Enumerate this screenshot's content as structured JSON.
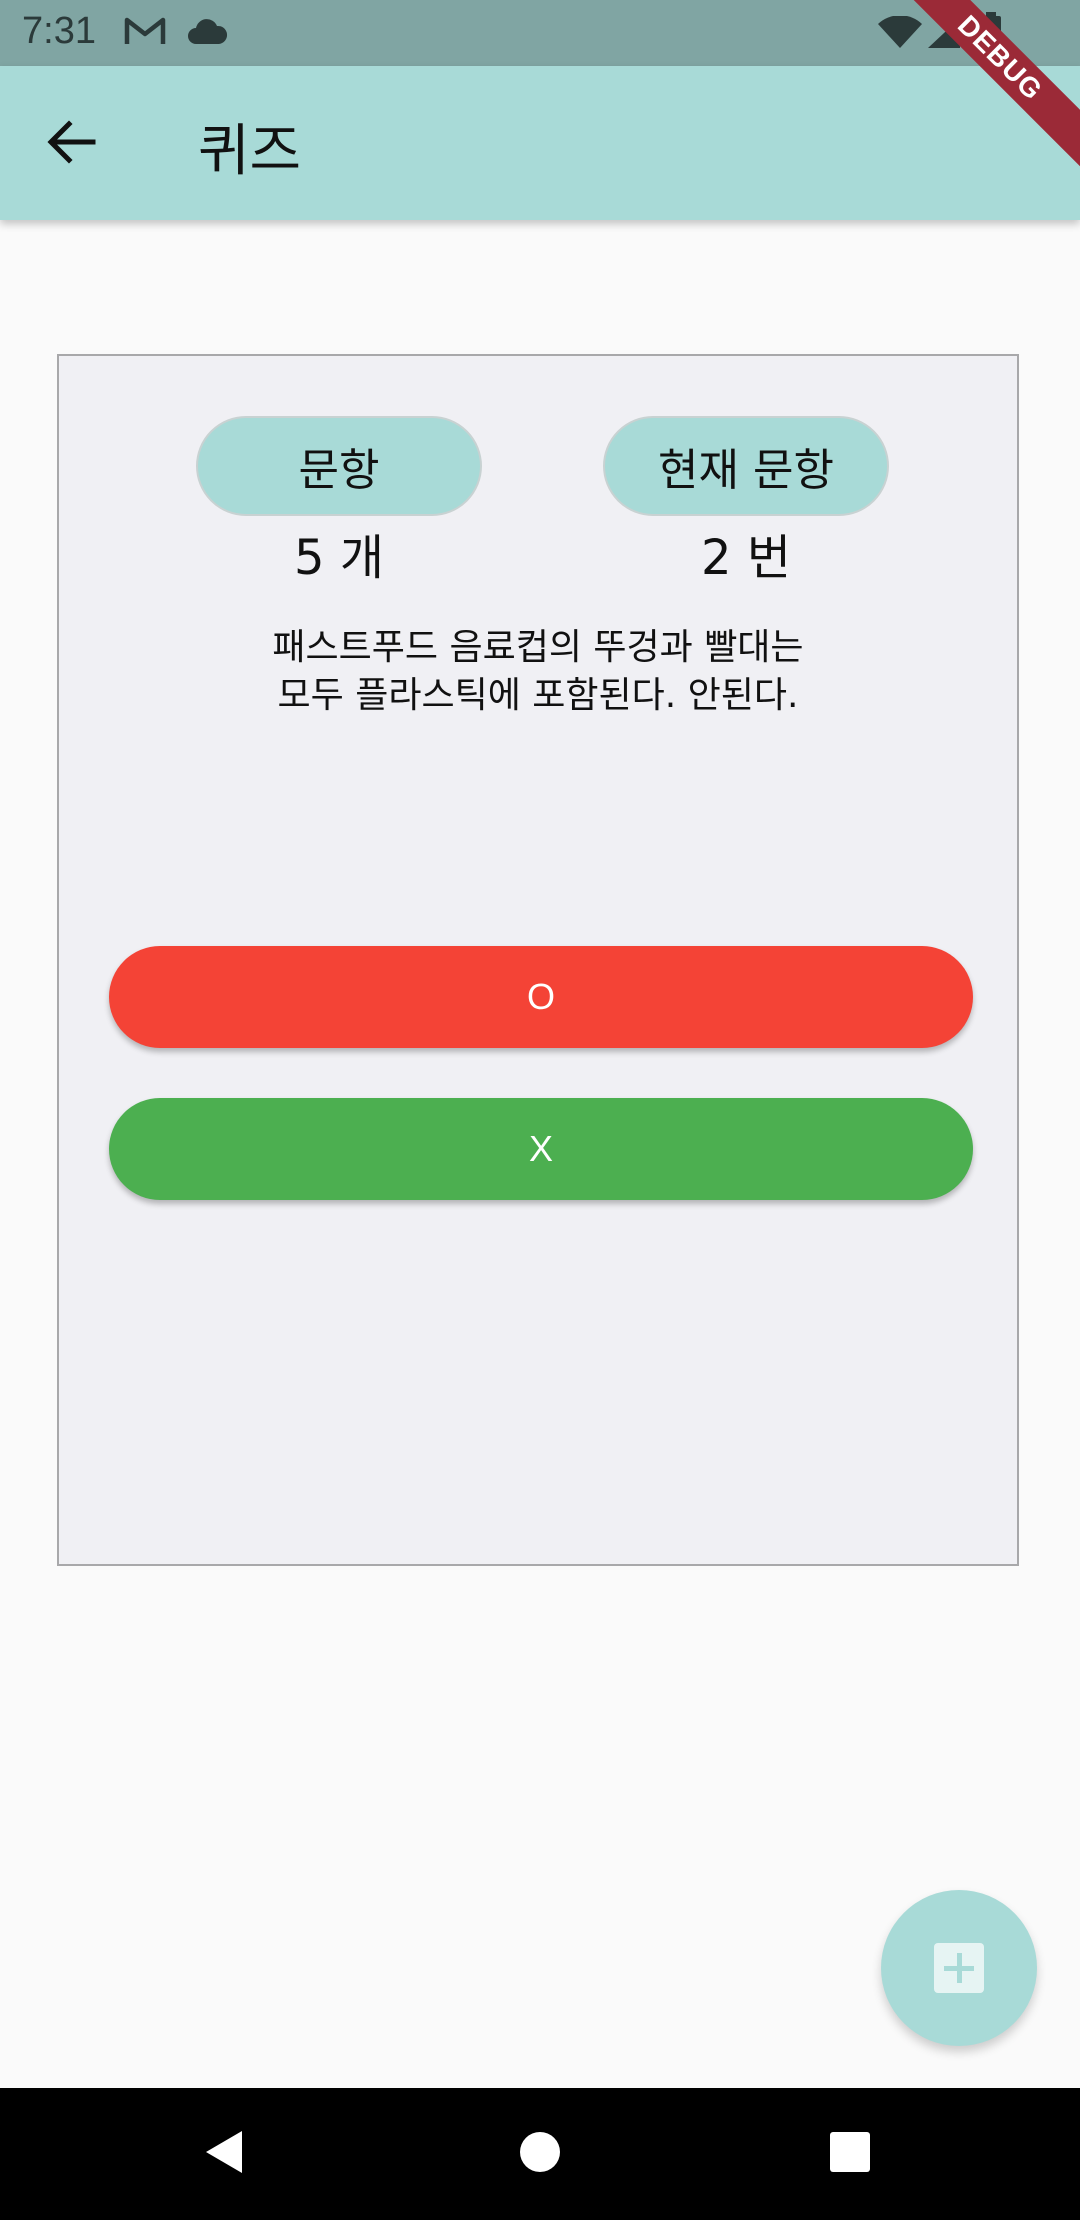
{
  "status_bar": {
    "time": "7:31",
    "icons": [
      "gmail-icon",
      "cloud-icon",
      "wifi-icon",
      "signal-icon",
      "battery-icon"
    ]
  },
  "debug_banner": {
    "label": "DEBUG"
  },
  "app_bar": {
    "title": "퀴즈",
    "back_icon": "arrow-back-icon"
  },
  "quiz": {
    "count_label": "문항",
    "count_value": "5 개",
    "current_label": "현재 문항",
    "current_value": "2 번",
    "question_lines": [
      "패스트푸드 음료컵의 뚜겅과 빨대는",
      "모두 플라스틱에 포함된다. 안된다."
    ],
    "answer_o": "O",
    "answer_x": "X"
  },
  "fab": {
    "icon": "add-box-icon"
  },
  "nav_bar": {
    "icons": [
      "nav-back-icon",
      "nav-home-icon",
      "nav-recents-icon"
    ]
  },
  "colors": {
    "primary": "#a8dad7",
    "status_bar": "#80a5a3",
    "card_bg": "#f0f0f4",
    "answer_o": "#f44336",
    "answer_x": "#4caf50",
    "debug": "#9b2a37"
  }
}
